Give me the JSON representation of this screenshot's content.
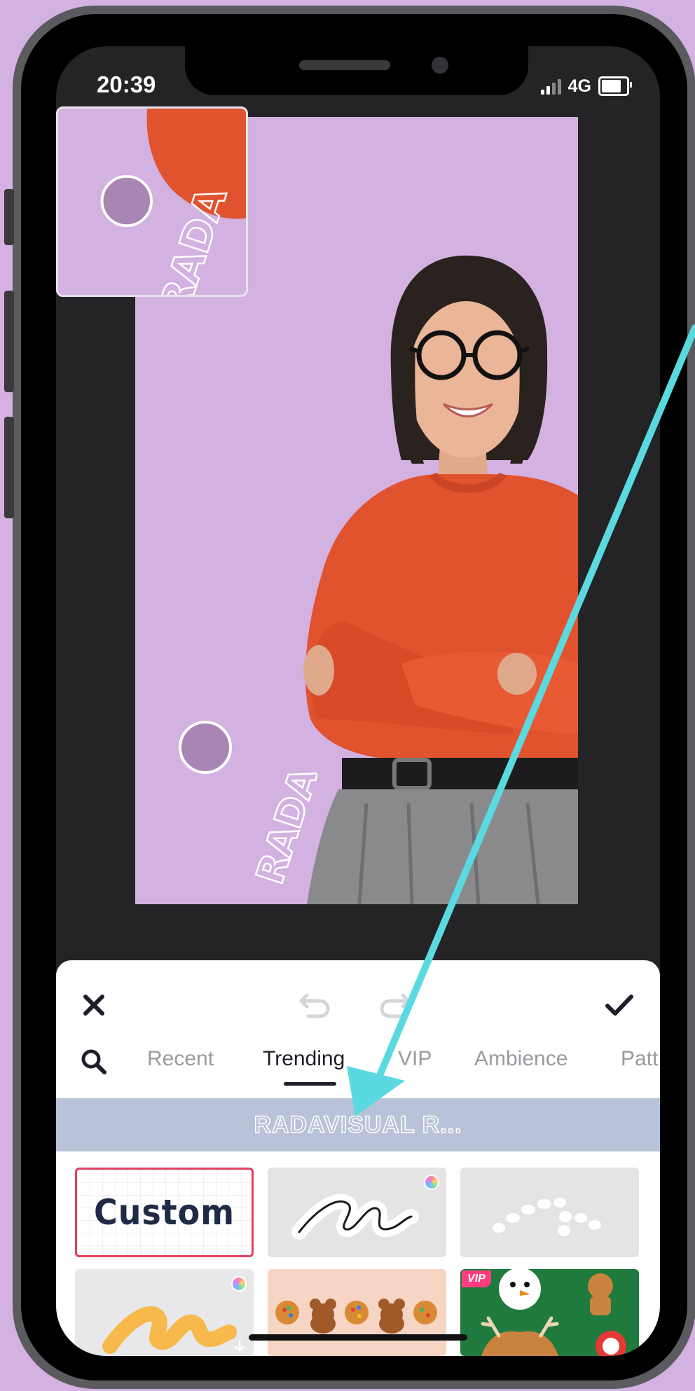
{
  "status_bar": {
    "time": "20:39",
    "network": "4G",
    "battery_level": 0.8
  },
  "canvas": {
    "background_color": "#d3b1e0",
    "sticker_text": "RADA"
  },
  "preview": {
    "sticker_text": "RADA"
  },
  "toolbar": {
    "close_icon": "close-icon",
    "undo_icon": "undo-icon",
    "redo_icon": "redo-icon",
    "confirm_icon": "checkmark-icon"
  },
  "tabs": {
    "search_icon": "search-icon",
    "items": [
      {
        "label": "Recent",
        "active": false
      },
      {
        "label": "Trending",
        "active": true
      },
      {
        "label": "VIP",
        "active": false
      },
      {
        "label": "Ambience",
        "active": false
      },
      {
        "label": "Patt",
        "active": false
      }
    ]
  },
  "banner": {
    "label": "RADAVISUAL R..."
  },
  "stickers": {
    "custom_label": "Custom",
    "vip_badge": "VIP"
  },
  "colors": {
    "accent": "#1e1e2a",
    "arrow": "#5ad9e0",
    "custom_border": "#e0415f",
    "sweater": "#e1522e"
  }
}
